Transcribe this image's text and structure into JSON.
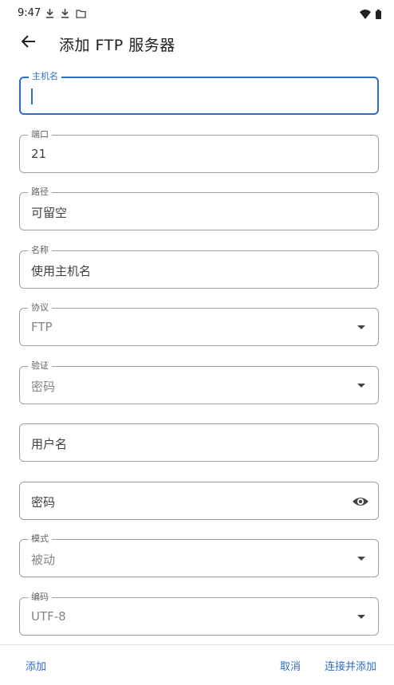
{
  "status_bar": {
    "time": "9:47",
    "left_icons": [
      "download-icon",
      "download-icon",
      "folder-icon"
    ],
    "right_icons": [
      "wifi-icon",
      "battery-icon"
    ]
  },
  "app_bar": {
    "title": "添加 FTP 服务器"
  },
  "form": {
    "host": {
      "label": "主机名",
      "value": ""
    },
    "port": {
      "label": "端口",
      "value": "21"
    },
    "path": {
      "label": "路径",
      "value": "可留空"
    },
    "name": {
      "label": "名称",
      "value": "使用主机名"
    },
    "protocol": {
      "label": "协议",
      "value": "FTP"
    },
    "auth": {
      "label": "验证",
      "value": "密码"
    },
    "username": {
      "placeholder": "用户名"
    },
    "password": {
      "placeholder": "密码"
    },
    "mode": {
      "label": "模式",
      "value": "被动"
    },
    "encoding": {
      "label": "编码",
      "value": "UTF-8"
    }
  },
  "actions": {
    "add": "添加",
    "cancel": "取消",
    "connect_add": "连接并添加"
  },
  "colors": {
    "accent": "#2f6cc5",
    "outline": "#9aa0a6"
  }
}
